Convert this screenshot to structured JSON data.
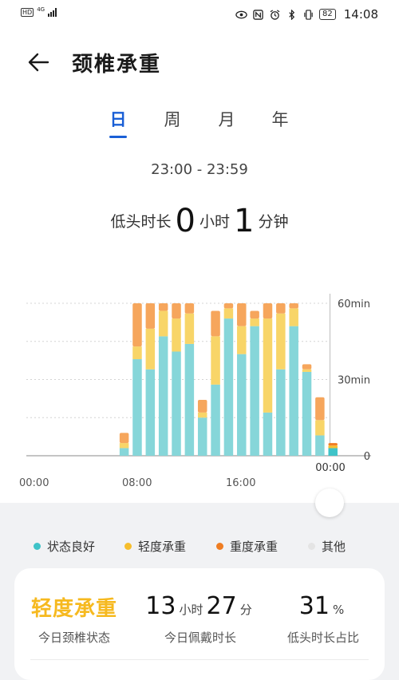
{
  "status_bar": {
    "hd": "HD",
    "network": "4G",
    "battery": "82",
    "time": "14:08"
  },
  "header": {
    "title": "颈椎承重"
  },
  "tabs": [
    {
      "label": "日",
      "active": true
    },
    {
      "label": "周",
      "active": false
    },
    {
      "label": "月",
      "active": false
    },
    {
      "label": "年",
      "active": false
    }
  ],
  "range_label": "23:00 - 23:59",
  "summary": {
    "prefix": "低头时长",
    "hours": "0",
    "hours_unit": "小时",
    "minutes": "1",
    "minutes_unit": "分钟"
  },
  "chart_data": {
    "type": "bar",
    "stacked": true,
    "x_ticks": [
      "00:00",
      "08:00",
      "16:00"
    ],
    "selected_label": "00:00",
    "y_ticks": [
      "60min",
      "30min",
      "0"
    ],
    "ylim": [
      0,
      60
    ],
    "colors": {
      "good": "#86d6d9",
      "light": "#f8d568",
      "heavy": "#f6a65c",
      "other": "#e6e6e6"
    },
    "series_names": [
      "状态良好",
      "轻度承重",
      "重度承重"
    ],
    "bars": [
      {
        "hour": 7,
        "good": 3,
        "light": 2,
        "heavy": 4
      },
      {
        "hour": 8,
        "good": 38,
        "light": 5,
        "heavy": 17
      },
      {
        "hour": 9,
        "good": 34,
        "light": 16,
        "heavy": 10
      },
      {
        "hour": 10,
        "good": 47,
        "light": 10,
        "heavy": 3
      },
      {
        "hour": 11,
        "good": 41,
        "light": 13,
        "heavy": 6
      },
      {
        "hour": 12,
        "good": 44,
        "light": 12,
        "heavy": 4
      },
      {
        "hour": 13,
        "good": 15,
        "light": 2,
        "heavy": 5
      },
      {
        "hour": 14,
        "good": 28,
        "light": 19,
        "heavy": 10
      },
      {
        "hour": 15,
        "good": 54,
        "light": 4,
        "heavy": 2
      },
      {
        "hour": 16,
        "good": 40,
        "light": 11,
        "heavy": 9
      },
      {
        "hour": 17,
        "good": 51,
        "light": 3,
        "heavy": 3
      },
      {
        "hour": 18,
        "good": 17,
        "light": 37,
        "heavy": 6
      },
      {
        "hour": 19,
        "good": 34,
        "light": 22,
        "heavy": 4
      },
      {
        "hour": 20,
        "good": 51,
        "light": 7,
        "heavy": 2
      },
      {
        "hour": 21,
        "good": 33,
        "light": 1,
        "heavy": 2
      },
      {
        "hour": 22,
        "good": 8,
        "light": 6,
        "heavy": 9
      },
      {
        "hour": 23,
        "good": 3,
        "light": 1,
        "heavy": 1,
        "selected": true
      }
    ]
  },
  "legend": [
    {
      "label": "状态良好",
      "color": "#3fc3c8"
    },
    {
      "label": "轻度承重",
      "color": "#f6be2d"
    },
    {
      "label": "重度承重",
      "color": "#ef7d22"
    },
    {
      "label": "其他",
      "color": "#e4e4e4"
    }
  ],
  "stats": {
    "state_value": "轻度承重",
    "state_label": "今日颈椎状态",
    "wear_hours": "13",
    "wear_hours_unit": "小时",
    "wear_minutes": "27",
    "wear_minutes_unit": "分",
    "wear_label": "今日佩戴时长",
    "ratio_value": "31",
    "ratio_unit": "%",
    "ratio_label": "低头时长占比"
  }
}
